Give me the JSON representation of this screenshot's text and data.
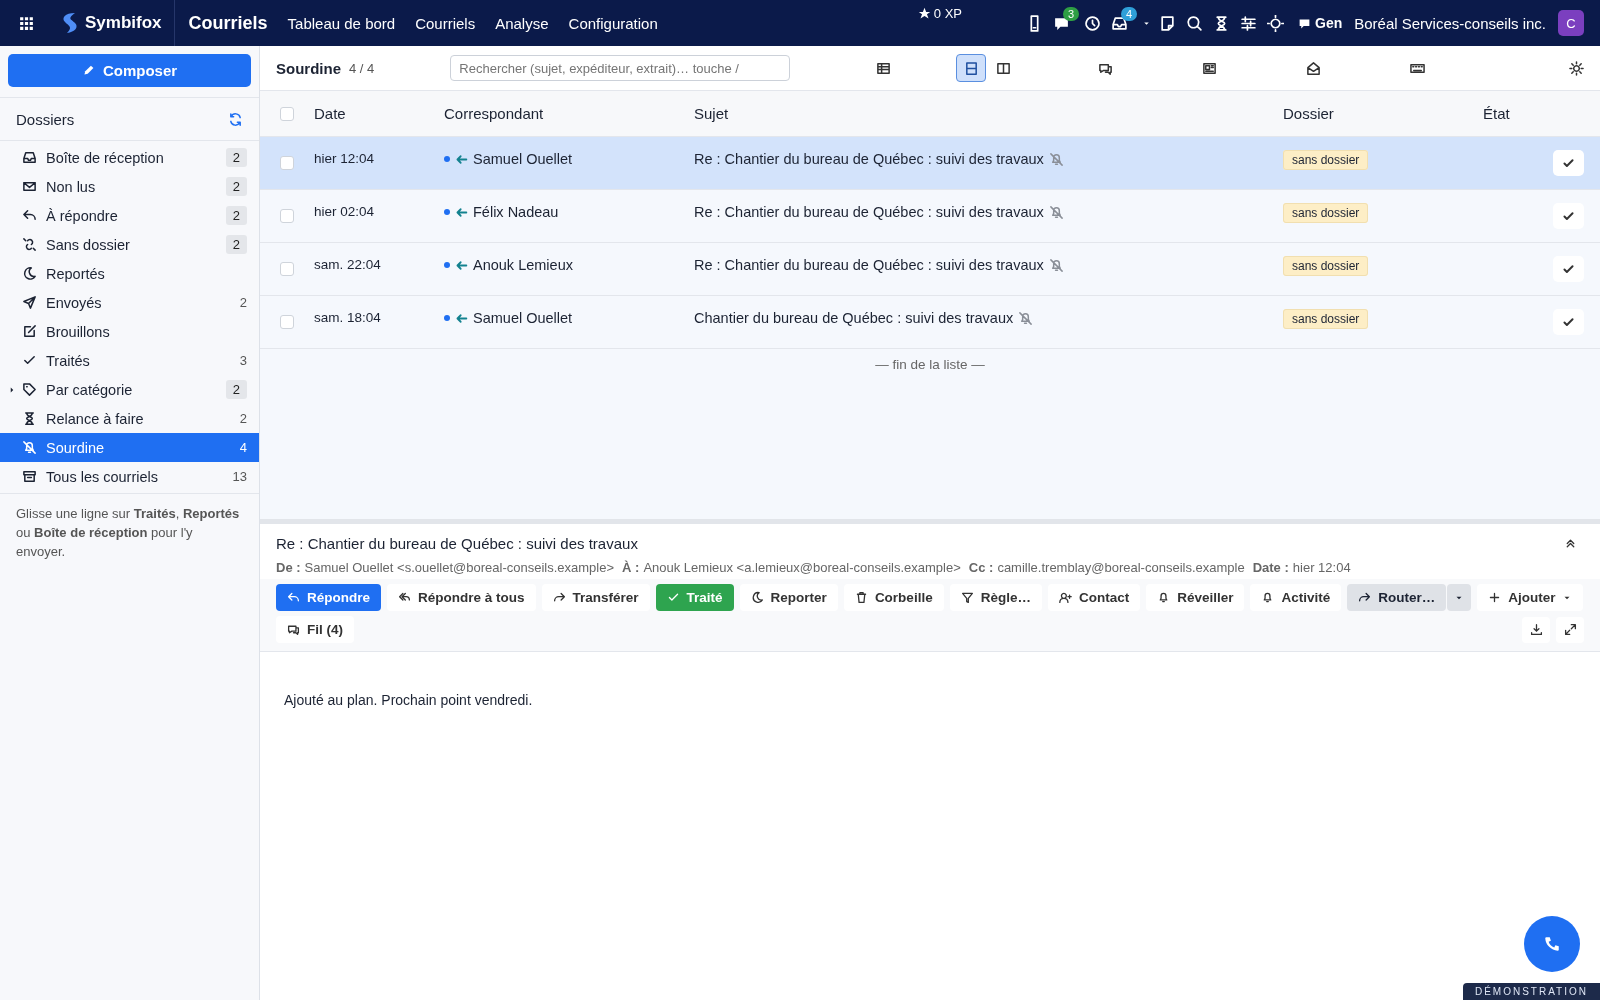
{
  "topbar": {
    "app_name": "Symbifox",
    "section": "Courriels",
    "nav": [
      "Tableau de bord",
      "Courriels",
      "Analyse",
      "Configuration"
    ],
    "xp": "0 XP",
    "chat_count": "3",
    "inbox_count": "4",
    "assistant": "Gen",
    "organization": "Boréal Services-conseils inc.",
    "avatar": "C"
  },
  "sidebar": {
    "compose": "Composer",
    "folders_title": "Dossiers",
    "folders": [
      {
        "label": "Boîte de réception",
        "count": "2",
        "badge": true,
        "selected": false
      },
      {
        "label": "Non lus",
        "count": "2",
        "badge": true,
        "selected": false
      },
      {
        "label": "À répondre",
        "count": "2",
        "badge": true,
        "selected": false
      },
      {
        "label": "Sans dossier",
        "count": "2",
        "badge": true,
        "selected": false
      },
      {
        "label": "Reportés",
        "selected": false
      },
      {
        "label": "Envoyés",
        "count": "2",
        "badge": false,
        "selected": false
      },
      {
        "label": "Brouillons",
        "selected": false
      },
      {
        "label": "Traités",
        "count": "3",
        "badge": false,
        "selected": false
      },
      {
        "label": "Par catégorie",
        "count": "2",
        "badge": true,
        "selected": false,
        "expanded": false
      },
      {
        "label": "Relance à faire",
        "count": "2",
        "badge": false,
        "selected": false
      },
      {
        "label": "Sourdine",
        "count": "4",
        "badge": false,
        "selected": true
      },
      {
        "label": "Tous les courriels",
        "count": "13",
        "badge": false,
        "selected": false
      }
    ],
    "hint": "Glisse une ligne sur **Traités**, **Reportés** ou **Boîte de réception** pour l'y envoyer."
  },
  "list": {
    "title": "Sourdine",
    "count": "4 / 4",
    "search_placeholder": "Rechercher (sujet, expéditeur, extrait)… touche /",
    "views": [
      {
        "selected": false
      },
      {
        "selected": true
      },
      {
        "selected": false
      },
      {
        "selected": false
      },
      {
        "selected": false
      },
      {
        "selected": false
      },
      {
        "selected": false
      }
    ],
    "select_all_checked": false,
    "columns": [
      "Date",
      "Correspondant",
      "Sujet",
      "Dossier",
      "État"
    ],
    "rows": [
      {
        "selected": true,
        "checked": false,
        "date": "hier 12:04",
        "unread": true,
        "correspondent": "Samuel Ouellet",
        "subject": "Re : Chantier du bureau de Québec : suivi des travaux",
        "folder": "sans dossier"
      },
      {
        "selected": false,
        "checked": false,
        "date": "hier 02:04",
        "unread": true,
        "correspondent": "Félix Nadeau",
        "subject": "Re : Chantier du bureau de Québec : suivi des travaux",
        "folder": "sans dossier"
      },
      {
        "selected": false,
        "checked": false,
        "date": "sam. 22:04",
        "unread": true,
        "correspondent": "Anouk Lemieux",
        "subject": "Re : Chantier du bureau de Québec : suivi des travaux",
        "folder": "sans dossier"
      },
      {
        "selected": false,
        "checked": false,
        "date": "sam. 18:04",
        "unread": true,
        "correspondent": "Samuel Ouellet",
        "subject": "Chantier du bureau de Québec : suivi des travaux",
        "folder": "sans dossier"
      }
    ],
    "end_note": "— fin de la liste —"
  },
  "preview": {
    "subject": "Re : Chantier du bureau de Québec : suivi des travaux",
    "meta": [
      {
        "label": "De :",
        "value": "Samuel Ouellet <s.ouellet@boreal-conseils.example>"
      },
      {
        "label": "À :",
        "value": "Anouk Lemieux <a.lemieux@boreal-conseils.example>"
      },
      {
        "label": "Cc :",
        "value": "camille.tremblay@boreal-conseils.example"
      },
      {
        "label": "Date :",
        "value": "hier 12:04"
      }
    ],
    "actions": [
      {
        "kind": "primary",
        "label": "Répondre"
      },
      {
        "kind": "default",
        "label": "Répondre à tous"
      },
      {
        "kind": "default",
        "label": "Transférer"
      },
      {
        "kind": "success",
        "label": "Traité"
      },
      {
        "kind": "default",
        "label": "Reporter"
      },
      {
        "kind": "default",
        "label": "Corbeille"
      },
      {
        "kind": "default",
        "label": "Règle…"
      },
      {
        "kind": "default",
        "label": "Contact"
      },
      {
        "kind": "default",
        "label": "Réveiller"
      },
      {
        "kind": "default",
        "label": "Activité"
      },
      {
        "kind": "split",
        "label": "Router…"
      },
      {
        "kind": "menu",
        "label": "Ajouter"
      },
      {
        "kind": "default",
        "label": "Fil (4)"
      }
    ],
    "body": "Ajouté au plan. Prochain point vendredi."
  },
  "demo_badge": "DÉMONSTRATION"
}
